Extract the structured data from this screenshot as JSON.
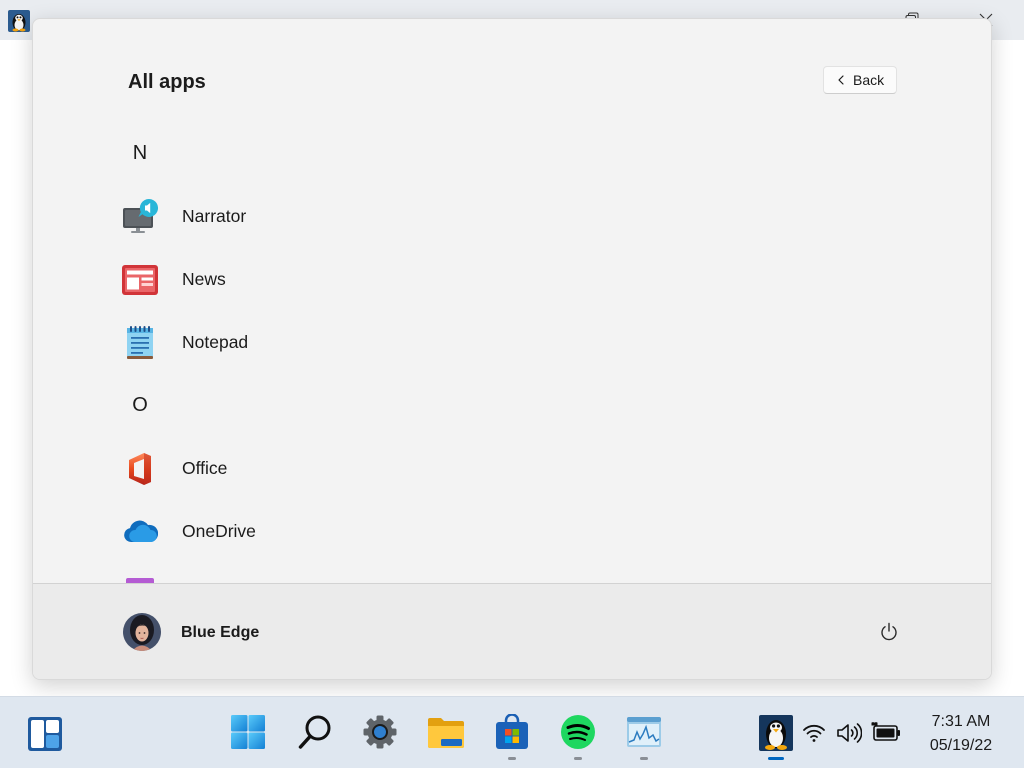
{
  "window": {
    "app_icon": "tux-icon",
    "controls": [
      "restore-icon",
      "close-icon"
    ]
  },
  "start_menu": {
    "title": "All apps",
    "back_button": {
      "label": "Back",
      "icon": "chevron-left-icon"
    },
    "sections": [
      {
        "letter": "N",
        "apps": [
          {
            "label": "Narrator",
            "icon": "narrator-icon"
          },
          {
            "label": "News",
            "icon": "news-icon"
          },
          {
            "label": "Notepad",
            "icon": "notepad-icon"
          }
        ]
      },
      {
        "letter": "O",
        "apps": [
          {
            "label": "Office",
            "icon": "office-icon"
          },
          {
            "label": "OneDrive",
            "icon": "onedrive-icon"
          },
          {
            "icon": "purple-app-icon"
          }
        ]
      }
    ],
    "user": {
      "name": "Blue Edge"
    },
    "power_icon": "power-icon"
  },
  "taskbar": {
    "widgets": {
      "icon": "widgets-icon"
    },
    "pinned": [
      {
        "icon": "windows-start-icon",
        "running": false
      },
      {
        "icon": "search-icon",
        "running": false
      },
      {
        "icon": "settings-gear-icon",
        "running": false
      },
      {
        "icon": "file-explorer-folder-icon",
        "running": false
      },
      {
        "icon": "microsoft-store-icon",
        "running": true
      },
      {
        "icon": "spotify-icon",
        "running": true
      },
      {
        "icon": "resource-monitor-icon",
        "running": true
      }
    ],
    "tray_app": {
      "icon": "tux-icon",
      "active": true
    },
    "quick_settings": [
      "wifi-icon",
      "volume-icon",
      "battery-icon"
    ],
    "clock": {
      "time": "7:31 AM",
      "date": "05/19/22"
    }
  },
  "colors": {
    "accent": "#0067c0",
    "panel_bg": "#f3f3f3",
    "footer_bg": "#ebebeb",
    "taskbar_bg": "#dfe7f0"
  }
}
